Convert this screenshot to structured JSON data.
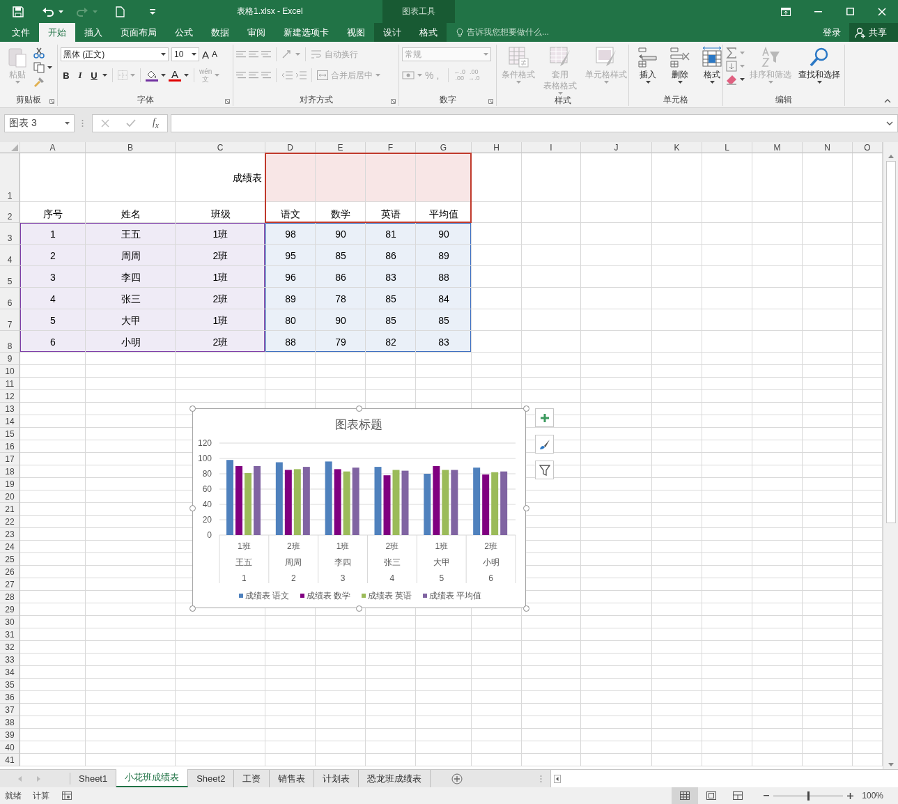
{
  "title_bar": {
    "title": "表格1.xlsx - Excel",
    "context_group": "图表工具",
    "redo": {
      "disabled": true
    }
  },
  "menu_tabs": [
    {
      "label": "文件",
      "selected": false,
      "kind": "standard"
    },
    {
      "label": "开始",
      "selected": true,
      "kind": "standard"
    },
    {
      "label": "插入",
      "selected": false,
      "kind": "standard"
    },
    {
      "label": "页面布局",
      "selected": false,
      "kind": "standard"
    },
    {
      "label": "公式",
      "selected": false,
      "kind": "standard"
    },
    {
      "label": "数据",
      "selected": false,
      "kind": "standard"
    },
    {
      "label": "审阅",
      "selected": false,
      "kind": "standard"
    },
    {
      "label": "新建选项卡",
      "selected": false,
      "kind": "standard"
    },
    {
      "label": "视图",
      "selected": false,
      "kind": "standard"
    },
    {
      "label": "设计",
      "selected": false,
      "kind": "contextual"
    },
    {
      "label": "格式",
      "selected": false,
      "kind": "contextual"
    }
  ],
  "tell_me": {
    "placeholder": "告诉我您想要做什么..."
  },
  "account": {
    "sign_in": "登录",
    "share": "共享"
  },
  "ribbon": {
    "clipboard": {
      "label": "剪贴板",
      "paste": {
        "label": "粘贴",
        "disabled": true
      }
    },
    "font": {
      "label": "字体",
      "font_name": "黑体 (正文)",
      "font_size": "10",
      "grow": "A",
      "shrink": "A",
      "bold": "B",
      "italic": "I",
      "underline": "U",
      "font_color": "A",
      "phonetic": [
        "wén",
        "文"
      ]
    },
    "alignment": {
      "label": "对齐方式",
      "wrap_text": {
        "label": "自动换行",
        "disabled": true
      },
      "merge": {
        "label": "合并后居中",
        "disabled": true
      }
    },
    "number": {
      "label": "数字",
      "format": "常规",
      "percent": "%",
      "comma": ",",
      "increase_decimal": [
        "←.0",
        ".00"
      ],
      "decrease_decimal": [
        ".00",
        "→.0"
      ]
    },
    "styles": {
      "label": "样式",
      "buttons": [
        {
          "lines": [
            "条件格式"
          ],
          "disabled": true,
          "kind": "conditional"
        },
        {
          "lines": [
            "套用",
            "表格格式"
          ],
          "disabled": true,
          "kind": "table"
        },
        {
          "lines": [
            "单元格样式"
          ],
          "disabled": true,
          "kind": "cellstyle"
        }
      ]
    },
    "cells": {
      "label": "单元格",
      "buttons": [
        {
          "lines": [
            "插入"
          ],
          "disabled": false,
          "kind": "insert"
        },
        {
          "lines": [
            "删除"
          ],
          "disabled": false,
          "kind": "delete"
        },
        {
          "lines": [
            "格式"
          ],
          "disabled": false,
          "kind": "format"
        }
      ]
    },
    "editing": {
      "label": "编辑",
      "buttons": [
        {
          "lines": [
            "排序和筛选"
          ],
          "disabled": true,
          "kind": "sort"
        },
        {
          "lines": [
            "查找和选择"
          ],
          "disabled": false,
          "kind": "find"
        }
      ]
    }
  },
  "formula_bar": {
    "name_box": "图表 3",
    "function_label": "f$_{x}$"
  },
  "sheet": {
    "columns": [
      "A",
      "B",
      "C",
      "D",
      "E",
      "F",
      "G",
      "H",
      "I",
      "J",
      "K",
      "L",
      "M",
      "N",
      "O"
    ],
    "row_numbers": [
      "1",
      "2",
      "3",
      "4",
      "5",
      "6",
      "7",
      "8",
      "9",
      "10",
      "11",
      "12",
      "13",
      "14",
      "15",
      "16",
      "17",
      "18",
      "19",
      "20",
      "21",
      "22",
      "23",
      "24",
      "25",
      "26",
      "27",
      "28",
      "29",
      "30",
      "31",
      "32",
      "33",
      "34",
      "35",
      "36",
      "37",
      "38",
      "39",
      "40",
      "41"
    ],
    "title_cell": "成绩表",
    "headers": [
      "序号",
      "姓名",
      "班级",
      "语文",
      "数学",
      "英语",
      "平均值"
    ],
    "records": [
      [
        "1",
        "王五",
        "1班",
        "98",
        "90",
        "81",
        "90"
      ],
      [
        "2",
        "周周",
        "2班",
        "95",
        "85",
        "86",
        "89"
      ],
      [
        "3",
        "李四",
        "1班",
        "96",
        "86",
        "83",
        "88"
      ],
      [
        "4",
        "张三",
        "2班",
        "89",
        "78",
        "85",
        "84"
      ],
      [
        "5",
        "大甲",
        "1班",
        "80",
        "90",
        "85",
        "85"
      ],
      [
        "6",
        "小明",
        "2班",
        "88",
        "79",
        "82",
        "83"
      ]
    ]
  },
  "chart": {
    "selected": true,
    "chart_data": {
      "type": "bar",
      "title": "图表标题",
      "categories": [
        [
          "1班",
          "王五",
          "1"
        ],
        [
          "2班",
          "周周",
          "2"
        ],
        [
          "1班",
          "李四",
          "3"
        ],
        [
          "2班",
          "张三",
          "4"
        ],
        [
          "1班",
          "大甲",
          "5"
        ],
        [
          "2班",
          "小明",
          "6"
        ]
      ],
      "series": [
        {
          "name": "成绩表 语文",
          "color": "#4f81bd",
          "values": [
            98,
            95,
            96,
            89,
            80,
            88
          ]
        },
        {
          "name": "成绩表 数学",
          "color": "#800080",
          "values": [
            90,
            85,
            86,
            78,
            90,
            79
          ]
        },
        {
          "name": "成绩表 英语",
          "color": "#9bbb59",
          "values": [
            81,
            86,
            83,
            85,
            85,
            82
          ]
        },
        {
          "name": "成绩表 平均值",
          "color": "#8064a2",
          "values": [
            90,
            89,
            88,
            84,
            85,
            83
          ]
        }
      ],
      "grid": true,
      "legend": "bottom",
      "ylim": [
        0,
        120
      ],
      "yticks": [
        0,
        20,
        40,
        60,
        80,
        100,
        120
      ]
    }
  },
  "sheet_tabs": [
    {
      "label": "Sheet1",
      "selected": false
    },
    {
      "label": "小花班成绩表",
      "selected": true
    },
    {
      "label": "Sheet2",
      "selected": false
    },
    {
      "label": "工资",
      "selected": false
    },
    {
      "label": "销售表",
      "selected": false
    },
    {
      "label": "计划表",
      "selected": false
    },
    {
      "label": "恐龙班成绩表",
      "selected": false
    }
  ],
  "status_bar": {
    "ready": "就绪",
    "calculate": "计算",
    "views": [
      {
        "kind": "normal",
        "selected": true
      },
      {
        "kind": "page_layout",
        "selected": false
      },
      {
        "kind": "page_break",
        "selected": false
      }
    ],
    "zoom": {
      "level": 0.5,
      "reading": "100%"
    }
  }
}
